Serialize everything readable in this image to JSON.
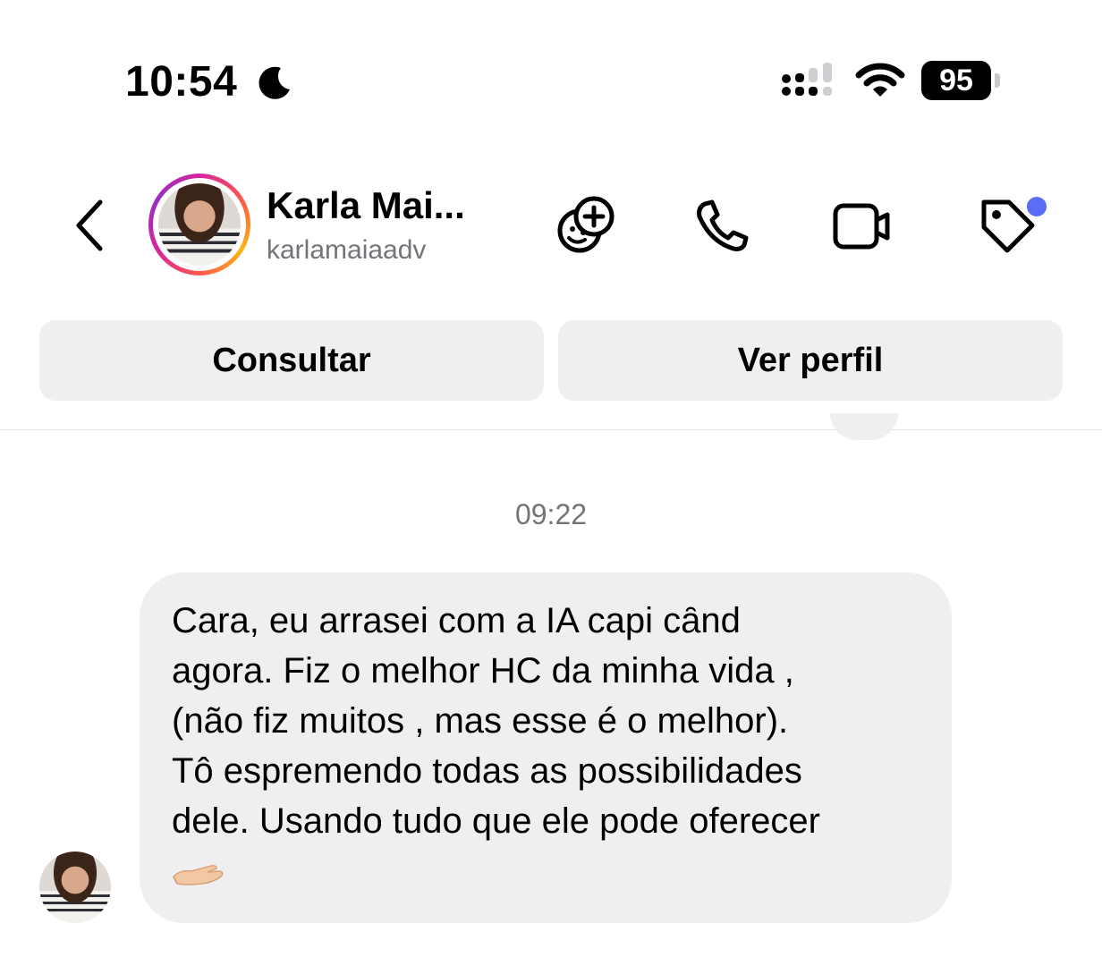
{
  "status_bar": {
    "time": "10:54",
    "battery": "95",
    "icons": [
      "moon-icon",
      "cellular-signal-icon",
      "wifi-icon",
      "battery-icon"
    ]
  },
  "header": {
    "name": "Karla Mai...",
    "username": "karlamaiaadv",
    "icons": [
      "back-chevron-icon",
      "sticker-add-icon",
      "phone-icon",
      "video-camera-icon",
      "tag-icon"
    ],
    "tag_dot_color": "#5b6cf5"
  },
  "actions": {
    "consultar": "Consultar",
    "ver_perfil": "Ver perfil"
  },
  "chat": {
    "timestamp": "09:22",
    "message": "Cara, eu arrasei com a IA capi cȃnd\nagora. Fiz o melhor HC da minha vida ,\n(não fiz muitos , mas esse é o melhor).\nTô espremendo todas as possibilidades\ndele. Usando tudo que ele pode oferecer",
    "message_emoji": "palm-up-hand-icon"
  },
  "colors": {
    "bubble_bg": "#efeff2",
    "secondary_text": "#73737a"
  }
}
